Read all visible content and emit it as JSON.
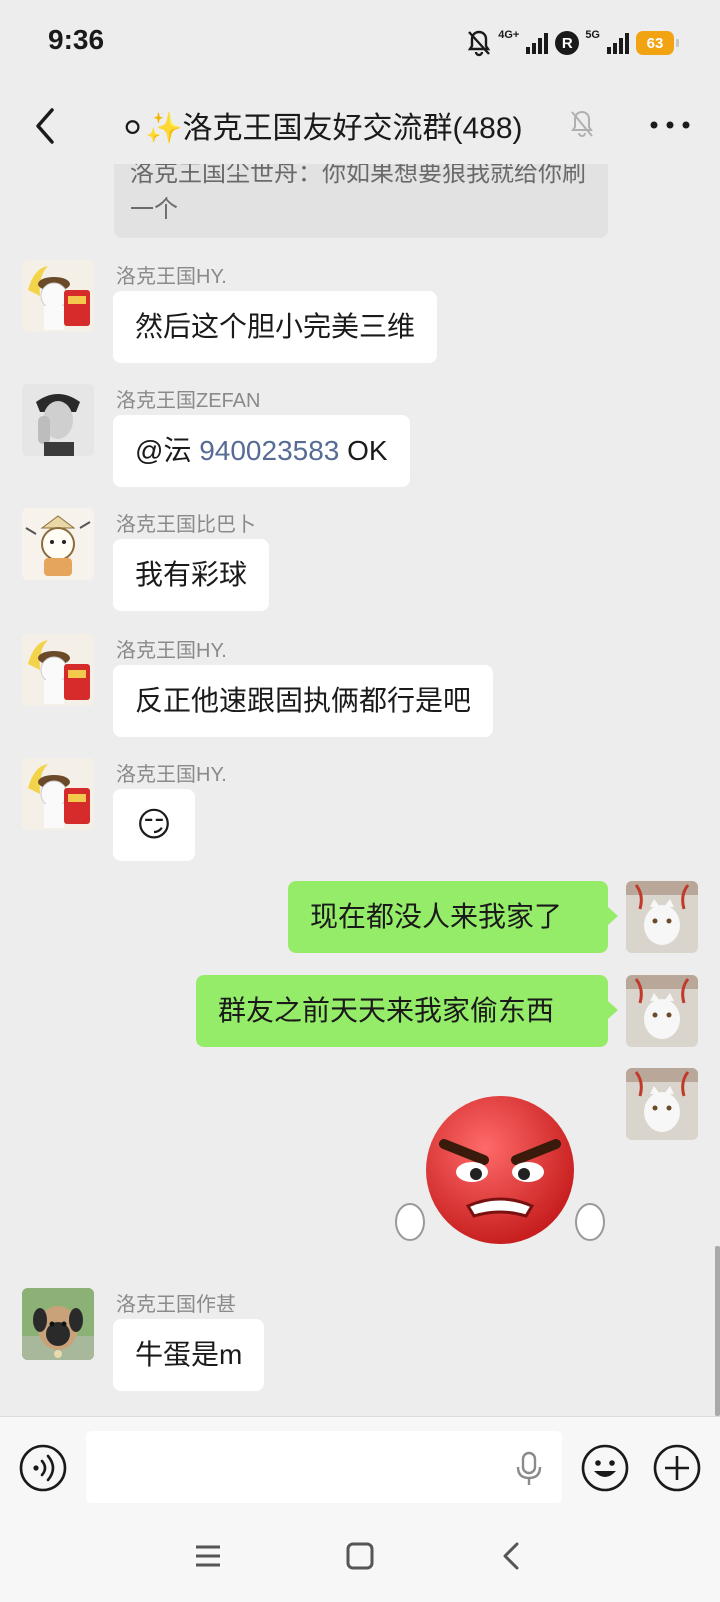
{
  "status_bar": {
    "time": "9:36",
    "network_1": "4G+",
    "network_2": "5G",
    "r_badge": "R",
    "battery": "63"
  },
  "header": {
    "title": "⚪✨洛克王国友好交流群(488)"
  },
  "chat": {
    "partial_message": "洛克王国尘世舟：你如果想要狼我就给你刷一个",
    "messages": [
      {
        "sender": "洛克王国HY.",
        "text": "然后这个胆小完美三维"
      },
      {
        "sender": "洛克王国ZEFAN",
        "mention": "@沄 ",
        "number": "940023583",
        "suffix": " OK"
      },
      {
        "sender": "洛克王国比巴卜",
        "text": "我有彩球"
      },
      {
        "sender": "洛克王国HY.",
        "text": "反正他速跟固执俩都行是吧"
      },
      {
        "sender": "洛克王国HY.",
        "emoji": "😏"
      },
      {
        "self": true,
        "text": "现在都没人来我家了"
      },
      {
        "self": true,
        "text": "群友之前天天来我家偷东西"
      },
      {
        "self": true,
        "sticker": "angry-face-sticker"
      },
      {
        "sender": "洛克王国作甚",
        "text": "牛蛋是m"
      }
    ]
  },
  "input_bar": {
    "placeholder": ""
  },
  "icons": [
    "back-arrow-icon",
    "mute-bell-icon",
    "more-dots-icon",
    "voice-icon",
    "mic-icon",
    "emoji-icon",
    "plus-icon",
    "menu-icon",
    "home-icon",
    "back-icon"
  ],
  "colors": {
    "self_bubble": "#95ec69",
    "background": "#ededed",
    "link": "#576b95",
    "battery": "#f2a312"
  }
}
